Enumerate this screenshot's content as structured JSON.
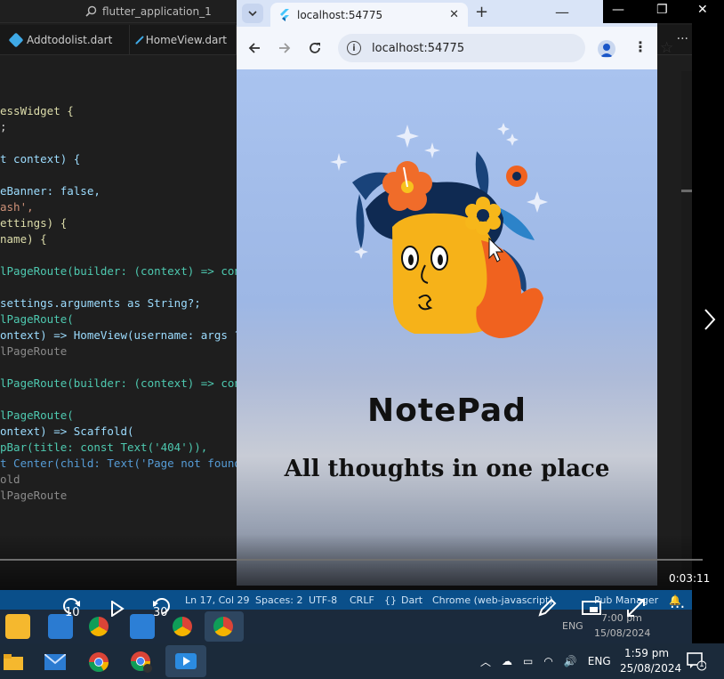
{
  "vscode": {
    "search_label": "flutter_application_1",
    "tabs": [
      {
        "label": "Addtodolist.dart"
      },
      {
        "label": "HomeView.dart"
      }
    ],
    "more": "···",
    "code_lines": [
      "essWidget {",
      ";",
      "",
      "t context) {",
      "",
      "eBanner: false,",
      "ash',",
      "ettings) {",
      "name) {",
      "",
      "lPageRoute(builder: (context) => con",
      "",
      "settings.arguments as String?;",
      "lPageRoute(",
      "ontext) => HomeView(username: args ??",
      "lPageRoute",
      "",
      "lPageRoute(builder: (context) => con",
      "",
      "lPageRoute(",
      "ontext) => Scaffold(",
      "pBar(title: const Text('404')),",
      "t Center(child: Text('Page not found",
      "old",
      "lPageRoute"
    ],
    "status": {
      "position": "Ln 17, Col 29",
      "spaces": "Spaces: 2",
      "encoding": "UTF-8",
      "eol": "CRLF",
      "language": "Dart",
      "device": "Chrome (web-javascript)",
      "pub": "Pub Manager"
    }
  },
  "browser": {
    "tab_title": "localhost:54775",
    "url": "localhost:54775",
    "page": {
      "title": "NotePad",
      "subtitle": "All thoughts in one place"
    }
  },
  "video": {
    "elapsed": "0:03:11",
    "rewind_label": "10",
    "forward_label": "30",
    "progress": 0.0
  },
  "inner_taskbar": {
    "lang": "ENG",
    "time": "7:00 pm",
    "date": "15/08/2024"
  },
  "taskbar": {
    "lang": "ENG",
    "time": "1:59 pm",
    "date": "25/08/2024",
    "notification_count": "1"
  },
  "colors": {
    "statusbar": "#0a4f8a",
    "taskbar": "#1b2a3a",
    "page_bg_top": "#a9c3ef"
  }
}
